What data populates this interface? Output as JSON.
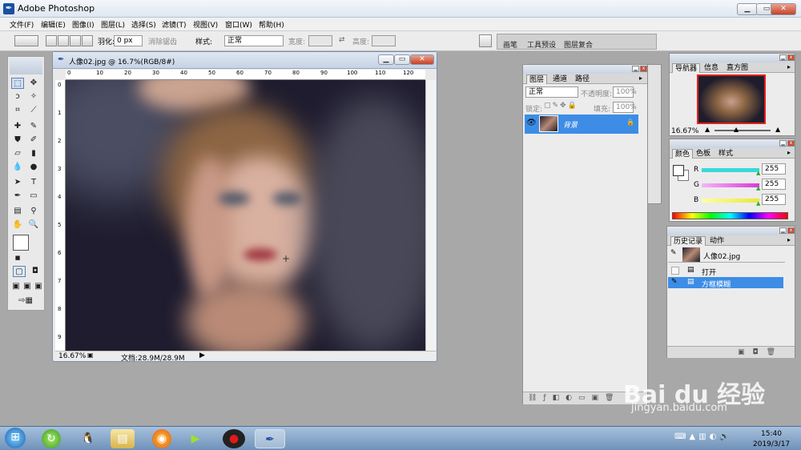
{
  "app": {
    "title": "Adobe Photoshop",
    "icon": "ps-feather-icon"
  },
  "menu": [
    "文件(F)",
    "编辑(E)",
    "图像(I)",
    "图层(L)",
    "选择(S)",
    "滤镜(T)",
    "视图(V)",
    "窗口(W)",
    "帮助(H)"
  ],
  "options": {
    "feather_label": "羽化:",
    "feather_value": "0 px",
    "antialias_label": "消除锯齿",
    "style_label": "样式:",
    "style_value": "正常",
    "width_label": "宽度:",
    "height_label": "高度:",
    "panel_tabs": [
      "画笔",
      "工具预设",
      "图层复合"
    ]
  },
  "document": {
    "title": "人像02.jpg @ 16.7%(RGB/8#)",
    "zoom": "16.67%",
    "doc_size": "文档:28.9M/28.9M",
    "ruler_h": [
      "0",
      "10",
      "20",
      "30",
      "40",
      "50",
      "60",
      "70",
      "80",
      "90",
      "100",
      "110",
      "120"
    ],
    "ruler_v": [
      "0",
      "1",
      "2",
      "3",
      "4",
      "5",
      "6",
      "7",
      "8",
      "9"
    ]
  },
  "layers_panel": {
    "tabs": [
      "图层",
      "通道",
      "路径"
    ],
    "blend_mode": "正常",
    "opacity_label": "不透明度:",
    "opacity_value": "100%",
    "lock_label": "锁定:",
    "fill_label": "填充:",
    "fill_value": "100%",
    "layer_name": "背景"
  },
  "navigator_panel": {
    "tabs": [
      "导航器",
      "信息",
      "直方图"
    ],
    "zoom": "16.67%"
  },
  "color_panel": {
    "tabs": [
      "颜色",
      "色板",
      "样式"
    ],
    "channels": [
      {
        "label": "R",
        "value": "255",
        "color": "#39d9d9"
      },
      {
        "label": "G",
        "value": "255",
        "color": "#d939d9"
      },
      {
        "label": "B",
        "value": "255",
        "color": "#e8e839"
      }
    ]
  },
  "history_panel": {
    "tabs": [
      "历史记录",
      "动作"
    ],
    "snapshot": "人像02.jpg",
    "items": [
      "打开",
      "方框模糊"
    ]
  },
  "taskbar": {
    "time": "15:40",
    "date": "2019/3/17",
    "apps": [
      "start-orb-icon",
      "refresh-app-icon",
      "qq-icon",
      "explorer-icon",
      "firefox-icon",
      "media-player-icon",
      "record-icon",
      "photoshop-icon"
    ]
  },
  "watermark": {
    "brand": "Bai du 经验",
    "url": "jingyan.baidu.com"
  },
  "colors": {
    "selection_blue": "#3d8de6",
    "canvas_bg": "#a8a8a8"
  }
}
